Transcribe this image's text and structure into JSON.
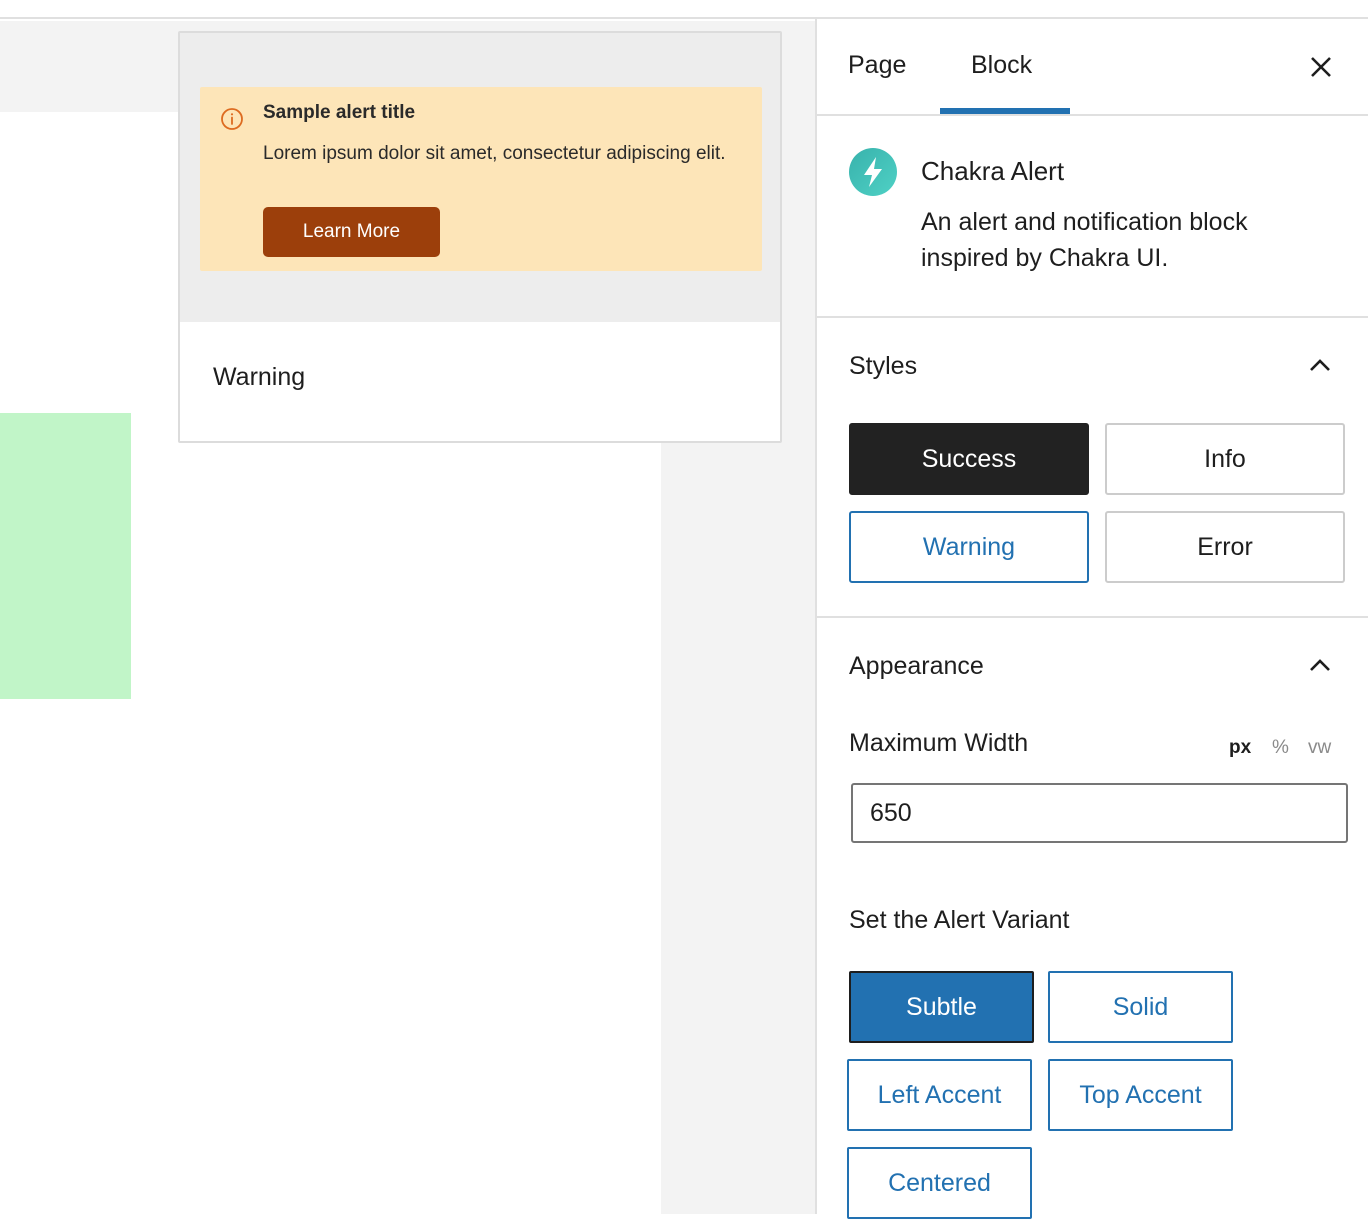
{
  "preview": {
    "alert_title": "Sample alert title",
    "alert_description": "Lorem ipsum dolor sit amet, consectetur adipiscing elit.",
    "alert_button": "Learn More",
    "style_label": "Warning"
  },
  "sidebar": {
    "tabs": [
      {
        "label": "Page"
      },
      {
        "label": "Block"
      }
    ],
    "block": {
      "title": "Chakra Alert",
      "description": "An alert and notification block inspired by Chakra UI."
    },
    "styles": {
      "title": "Styles",
      "options": [
        "Success",
        "Info",
        "Warning",
        "Error"
      ],
      "selected": "Success"
    },
    "appearance": {
      "title": "Appearance",
      "max_width_label": "Maximum Width",
      "units": [
        "px",
        "%",
        "vw"
      ],
      "selected_unit": "px",
      "max_width_value": "650",
      "variant_label": "Set the Alert Variant",
      "variants": [
        "Subtle",
        "Solid",
        "Left Accent",
        "Top Accent",
        "Centered"
      ],
      "selected_variant": "Subtle"
    }
  },
  "colors": {
    "accent": "#2271b1",
    "alert_bg": "#fde5b8",
    "alert_button": "#9c3f0b",
    "green_block": "#c1f5c8"
  }
}
